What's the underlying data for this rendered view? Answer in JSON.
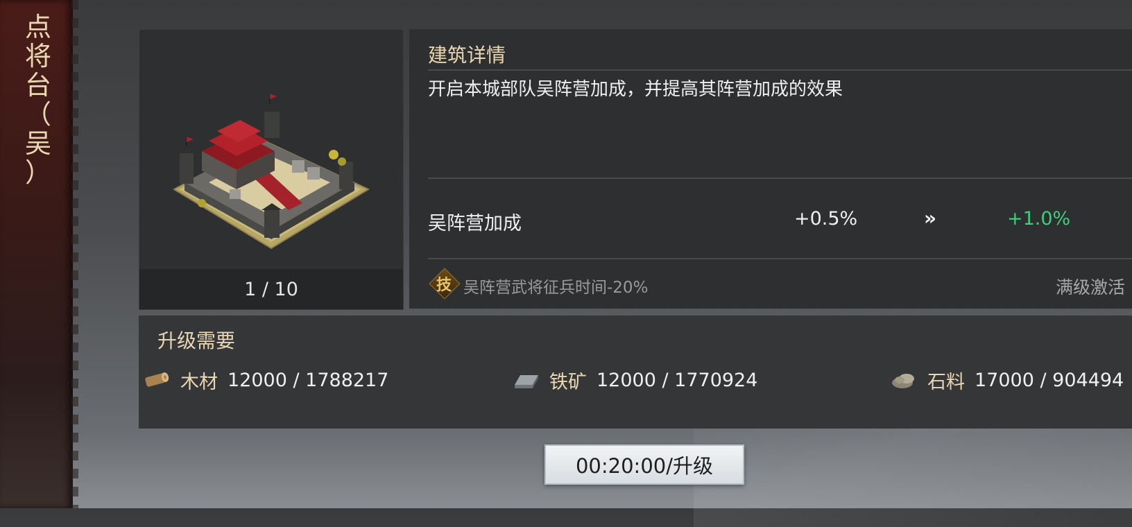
{
  "sidebar": {
    "title_chars": [
      "点",
      "将",
      "台",
      "（",
      "吴",
      "）"
    ]
  },
  "building": {
    "level": "1 / 10"
  },
  "details": {
    "title": "建筑详情",
    "description": "开启本城部队吴阵营加成，并提高其阵营加成的效果",
    "bonus": {
      "name": "吴阵营加成",
      "current": "+0.5%",
      "arrow": "»",
      "next": "+1.0%"
    },
    "skill": {
      "badge": "技",
      "text": "吴阵营武将征兵时间-20%",
      "status": "满级激活"
    }
  },
  "requirements": {
    "title": "升级需要",
    "resources": [
      {
        "icon": "wood-log-icon",
        "name": "木材",
        "value": "12000 / 1788217"
      },
      {
        "icon": "iron-ingot-icon",
        "name": "铁矿",
        "value": "12000 / 1770924"
      },
      {
        "icon": "stone-icon",
        "name": "石料",
        "value": "17000 / 904494"
      }
    ]
  },
  "upgrade_button": {
    "label": "00:20:00/升级"
  },
  "colors": {
    "gold_text": "#e9d7b2",
    "green_bonus": "#3ccf7a",
    "panel": "#2e2f30"
  }
}
